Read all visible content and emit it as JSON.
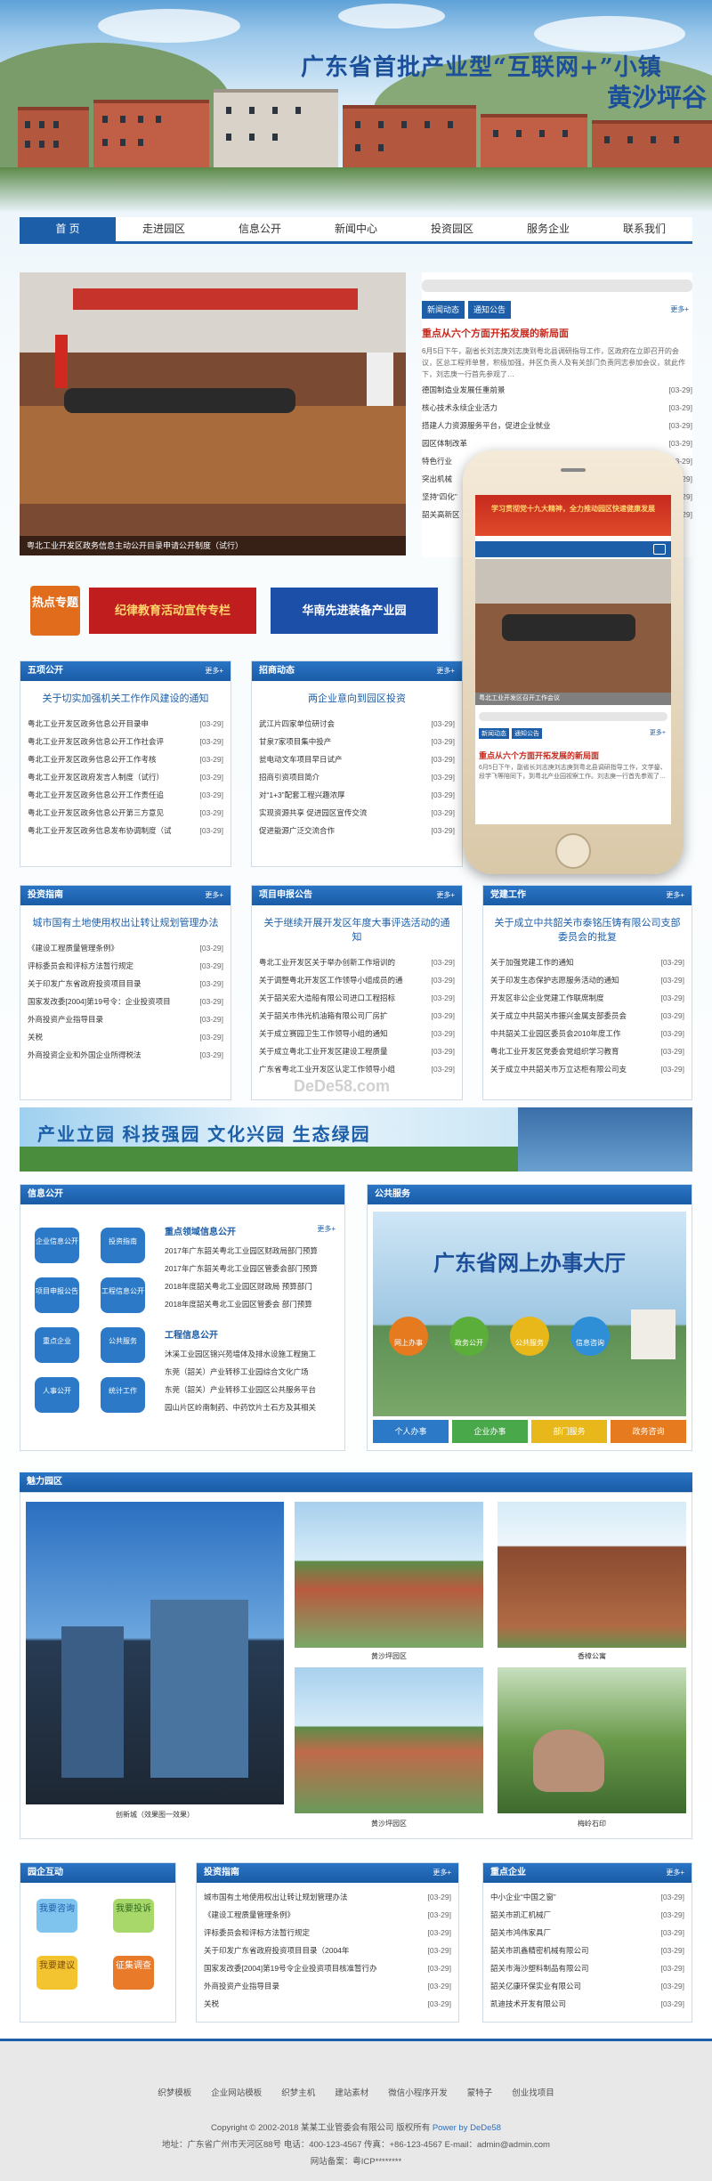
{
  "banner": {
    "line1": "广东省首批产业型“互联网+”小镇",
    "line2": "黄沙坪谷"
  },
  "nav": [
    "首 页",
    "走进园区",
    "信息公开",
    "新闻中心",
    "投资园区",
    "服务企业",
    "联系我们"
  ],
  "slider": {
    "caption": "粤北工业开发区政务信息主动公开目录申请公开制度（试行）"
  },
  "news": {
    "tabs": [
      "新闻动态",
      "通知公告"
    ],
    "more": "更多+",
    "headline": "重点从六个方面开拓发展的新局面",
    "summary": "6月5日下午，副省长刘志庚刘志庚到粤北县调研指导工作，区政府在立即召开的会议，区总工程师单曾，积极加强，并区负责人及有关部门负责同志参加会议，就此作下，刘志庚一行首先参观了…",
    "items": [
      [
        "德国制造业发展任重前景",
        "[03-29]"
      ],
      [
        "核心技术永续企业活力",
        "[03-29]"
      ],
      [
        "搭建人力资源服务平台，促进企业就业",
        "[03-29]"
      ],
      [
        "园区体制改革",
        "[03-29]"
      ],
      [
        "特色行业",
        "[03-29]"
      ],
      [
        "突出机械",
        "[03-29]"
      ],
      [
        "坚持“四化”",
        "[03-29]"
      ],
      [
        "韶关高新区",
        "[03-29]"
      ]
    ]
  },
  "phone": {
    "banner": "学习贯彻党十九大精神，全力推动园区快速健康发展",
    "caption": "粤北工业开发区召开工作会议",
    "headline": "重点从六个方面开拓发展的新局面",
    "summary": "6月5日下午，副省长刘志庚刘志庚到粤北县调研指导工作，文学鋆、段学飞等陪同下，到粤北产业园视察工作。刘志庚一行首先参观了…",
    "tabs": [
      "新闻动态",
      "通知公告"
    ],
    "more": "更多+"
  },
  "hot": {
    "label": "热点专题",
    "b1": "纪律教育活动宣传专栏",
    "b2": "华南先进装备产业园"
  },
  "gov": {
    "title": "五项公开",
    "more": "更多+",
    "lead": "关于切实加强机关工作作风建设的通知",
    "items": [
      [
        "粤北工业开发区政务信息公开目录申",
        "[03-29]"
      ],
      [
        "粤北工业开发区政务信息公开工作社会评",
        "[03-29]"
      ],
      [
        "粤北工业开发区政务信息公开工作考核",
        "[03-29]"
      ],
      [
        "粤北工业开发区政府发言人制度（试行）",
        "[03-29]"
      ],
      [
        "粤北工业开发区政务信息公开工作责任追",
        "[03-29]"
      ],
      [
        "粤北工业开发区政务信息公开第三方意见",
        "[03-29]"
      ],
      [
        "粤北工业开发区政务信息发布协调制度（试",
        "[03-29]"
      ]
    ]
  },
  "recruit": {
    "title": "招商动态",
    "more": "更多+",
    "lead": "两企业意向到园区投资",
    "items": [
      [
        "武江片四家单位研讨会",
        "[03-29]"
      ],
      [
        "甘泉7家项目集中投产",
        "[03-29]"
      ],
      [
        "瓮电动文车项目早日试产",
        "[03-29]"
      ],
      [
        "招商引资项目简介",
        "[03-29]"
      ],
      [
        "对“1+3”配套工程兴趣浓厚",
        "[03-29]"
      ],
      [
        "实现资源共享 促进园区宣传交流",
        "[03-29]"
      ],
      [
        "促进能源广泛交流合作",
        "[03-29]"
      ]
    ]
  },
  "invest": {
    "title": "投资指南",
    "more": "更多+",
    "lead": "城市国有土地使用权出让转让规划管理办法",
    "items": [
      [
        "《建设工程质量管理条例》",
        "[03-29]"
      ],
      [
        "评标委员会和评标方法暂行规定",
        "[03-29]"
      ],
      [
        "关于印发广东省政府投资项目目录",
        "[03-29]"
      ],
      [
        "国家发改委[2004]第19号令：企业投资项目",
        "[03-29]"
      ],
      [
        "外商投资产业指导目录",
        "[03-29]"
      ],
      [
        "关税",
        "[03-29]"
      ],
      [
        "外商投资企业和外国企业所得税法",
        "[03-29]"
      ]
    ]
  },
  "declare": {
    "title": "项目申报公告",
    "more": "更多+",
    "lead": "关于继续开展开发区年度大事评选活动的通知",
    "items": [
      [
        "粤北工业开发区关于举办创新工作培训的",
        "[03-29]"
      ],
      [
        "关于调整粤北开发区工作领导小组成员的通",
        "[03-29]"
      ],
      [
        "关于韶关宏大造船有限公司进口工程招标",
        "[03-29]"
      ],
      [
        "关于韶关市伟光机油箱有限公司厂房扩",
        "[03-29]"
      ],
      [
        "关于成立赛园卫生工作领导小组的通知",
        "[03-29]"
      ],
      [
        "关于成立粤北工业开发区建设工程质量",
        "[03-29]"
      ],
      [
        "广东省粤北工业开发区认定工作领导小组",
        "[03-29]"
      ]
    ]
  },
  "party": {
    "title": "党建工作",
    "more": "更多+",
    "lead": "关于成立中共韶关市泰铭压铸有限公司支部委员会的批复",
    "items": [
      [
        "关于加强党建工作的通知",
        "[03-29]"
      ],
      [
        "关于印发生态保护志愿服务活动的通知",
        "[03-29]"
      ],
      [
        "开发区非公企业党建工作联席制度",
        "[03-29]"
      ],
      [
        "关于成立中共韶关市振兴金属支部委员会",
        "[03-29]"
      ],
      [
        "中共韶关工业园区委员会2010年度工作",
        "[03-29]"
      ],
      [
        "粤北工业开发区党委会党组织学习教育",
        "[03-29]"
      ],
      [
        "关于成立中共韶关市万立达柜有限公司支",
        "[03-29]"
      ]
    ]
  },
  "slogan": "产业立园 科技强园 文化兴园 生态绿园",
  "info": {
    "title": "信息公开",
    "btns": [
      "企业信息公开",
      "投资指南",
      "项目申报公告",
      "工程信息公开",
      "重点企业",
      "公共服务",
      "人事公开",
      "统计工作"
    ],
    "sub1": "重点领域信息公开",
    "sub2": "工程信息公开",
    "more": "更多+",
    "list1": [
      "2017年广东韶关粤北工业园区财政局部门预算",
      "2017年广东韶关粤北工业园区管委会部门预算",
      "2018年度韶关粤北工业园区财政局 预算部门",
      "2018年度韶关粤北工业园区管委会 部门预算"
    ],
    "list2": [
      "沐溪工业园区锦兴苑墙体及排水设施工程施工",
      "东莞（韶关）产业转移工业园综合文化广场",
      "东莞（韶关）产业转移工业园区公共服务平台",
      "园山片区岭南制药、中药饮片土石方及其相关"
    ]
  },
  "svc": {
    "title": "公共服务",
    "big": "广东省网上办事大厅",
    "circles": [
      "网上办事",
      "政务公开",
      "公共服务",
      "信息咨询"
    ],
    "tabs": [
      "个人办事",
      "企业办事",
      "部门服务",
      "政务咨询"
    ]
  },
  "gallery": {
    "title": "魅力园区",
    "captions": [
      "创新城（效果图一效果）",
      "黄沙坪园区",
      "香樟公寓",
      "黄沙坪园区",
      "梅岭石印"
    ]
  },
  "interact": {
    "title": "园企互动",
    "btns": [
      "我要咨询",
      "我要投诉",
      "我要建议",
      "征集调查"
    ]
  },
  "invest2": {
    "title": "投资指南",
    "more": "更多+",
    "items": [
      [
        "城市国有土地使用权出让转让规划管理办法",
        "[03-29]"
      ],
      [
        "《建设工程质量管理条例》",
        "[03-29]"
      ],
      [
        "评标委员会和评标方法暂行规定",
        "[03-29]"
      ],
      [
        "关于印发广东省政府投资项目目录（2004年",
        "[03-29]"
      ],
      [
        "国家发改委[2004]第19号令企业投资项目核准暂行办",
        "[03-29]"
      ],
      [
        "外商投资产业指导目录",
        "[03-29]"
      ],
      [
        "关税",
        "[03-29]"
      ]
    ]
  },
  "keyent": {
    "title": "重点企业",
    "more": "更多+",
    "items": [
      [
        "中小企业“中国之窗”",
        "[03-29]"
      ],
      [
        "韶关市凯汇机械厂",
        "[03-29]"
      ],
      [
        "韶关市鸿伟家具厂",
        "[03-29]"
      ],
      [
        "韶关市凯鑫精密机械有限公司",
        "[03-29]"
      ],
      [
        "韶关市海沙塑料制品有限公司",
        "[03-29]"
      ],
      [
        "韶关亿康环保实业有限公司",
        "[03-29]"
      ],
      [
        "凯迪技术开发有限公司",
        "[03-29]"
      ]
    ]
  },
  "footer": {
    "links": [
      "织梦模板",
      "企业网站模板",
      "织梦主机",
      "建站素材",
      "微信小程序开发",
      "蒙特子",
      "创业找项目"
    ],
    "copy": "Copyright © 2002-2018 某某工业管委会有限公司 版权所有",
    "power": "Power by DeDe58",
    "addr": "地址：广东省广州市天河区88号 电话：400-123-4567  传真：+86-123-4567  E-mail：admin@admin.com",
    "icp": "网站备案：粤ICP********"
  },
  "watermark": "DeDe58.com"
}
